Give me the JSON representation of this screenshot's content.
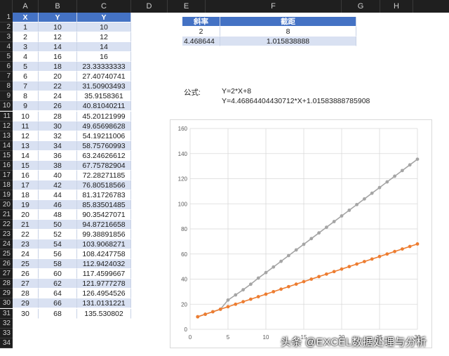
{
  "columns": [
    "A",
    "B",
    "C",
    "D",
    "E",
    "F",
    "G",
    "H"
  ],
  "rows": [
    "1",
    "2",
    "3",
    "4",
    "5",
    "6",
    "7",
    "8",
    "9",
    "10",
    "11",
    "12",
    "13",
    "14",
    "15",
    "16",
    "17",
    "18",
    "19",
    "20",
    "21",
    "22",
    "23",
    "24",
    "25",
    "26",
    "27",
    "28",
    "29",
    "30",
    "31",
    "32",
    "33",
    "34"
  ],
  "table": {
    "headers": [
      "X",
      "Y",
      "Y"
    ],
    "x": [
      "1",
      "2",
      "3",
      "4",
      "5",
      "6",
      "7",
      "8",
      "9",
      "10",
      "11",
      "12",
      "13",
      "14",
      "15",
      "16",
      "17",
      "18",
      "19",
      "20",
      "21",
      "22",
      "23",
      "24",
      "25",
      "26",
      "27",
      "28",
      "29",
      "30"
    ],
    "y1": [
      "10",
      "12",
      "14",
      "16",
      "18",
      "20",
      "22",
      "24",
      "26",
      "28",
      "30",
      "32",
      "34",
      "36",
      "38",
      "40",
      "42",
      "44",
      "46",
      "48",
      "50",
      "52",
      "54",
      "56",
      "58",
      "60",
      "62",
      "64",
      "66",
      "68"
    ],
    "y2": [
      "10",
      "12",
      "14",
      "16",
      "23.33333333",
      "27.40740741",
      "31.50903493",
      "35.9158361",
      "40.81040211",
      "45.20121999",
      "49.65698628",
      "54.19211006",
      "58.75760993",
      "63.24626612",
      "67.75782904",
      "72.28271185",
      "76.80518566",
      "81.31726783",
      "85.83501485",
      "90.35427071",
      "94.87216658",
      "99.38891856",
      "103.9068271",
      "108.4247758",
      "112.9424032",
      "117.4599667",
      "121.9777278",
      "126.4954526",
      "131.0131221",
      "135.530802"
    ]
  },
  "regression": {
    "headers": [
      "斜率",
      "截距"
    ],
    "row1": [
      "2",
      "8"
    ],
    "row2": [
      "4.468644",
      "1.015838888"
    ]
  },
  "formula": {
    "label": "公式:",
    "line1": "Y=2*X+8",
    "line2": "Y=4.46864404430712*X+1.01583888785908"
  },
  "chart_data": {
    "type": "line",
    "x": [
      1,
      2,
      3,
      4,
      5,
      6,
      7,
      8,
      9,
      10,
      11,
      12,
      13,
      14,
      15,
      16,
      17,
      18,
      19,
      20,
      21,
      22,
      23,
      24,
      25,
      26,
      27,
      28,
      29,
      30
    ],
    "series": [
      {
        "name": "",
        "color": "#a5a5a5",
        "values": [
          10,
          12,
          14,
          16,
          23.33,
          27.41,
          31.51,
          35.92,
          40.81,
          45.2,
          49.66,
          54.19,
          58.76,
          63.25,
          67.76,
          72.28,
          76.81,
          81.32,
          85.84,
          90.35,
          94.87,
          99.39,
          103.91,
          108.42,
          112.94,
          117.46,
          121.98,
          126.5,
          131.01,
          135.53
        ]
      },
      {
        "name": "",
        "color": "#ed7d31",
        "values": [
          10,
          12,
          14,
          16,
          18,
          20,
          22,
          24,
          26,
          28,
          30,
          32,
          34,
          36,
          38,
          40,
          42,
          44,
          46,
          48,
          50,
          52,
          54,
          56,
          58,
          60,
          62,
          64,
          66,
          68
        ]
      }
    ],
    "xlim": [
      0,
      30
    ],
    "ylim": [
      0,
      160
    ],
    "x_ticks": [
      "0",
      "5",
      "10",
      "15",
      "20",
      "25",
      "30"
    ],
    "y_ticks": [
      "0",
      "20",
      "40",
      "60",
      "80",
      "100",
      "120",
      "140",
      "160"
    ],
    "grid": true,
    "title": ""
  },
  "watermark": "头条 @EXCEL数据处理与分析",
  "colors": {
    "header_blue": "#4472c4",
    "band_blue": "#d9e1f2",
    "gray_series": "#a5a5a5",
    "orange_series": "#ed7d31"
  }
}
